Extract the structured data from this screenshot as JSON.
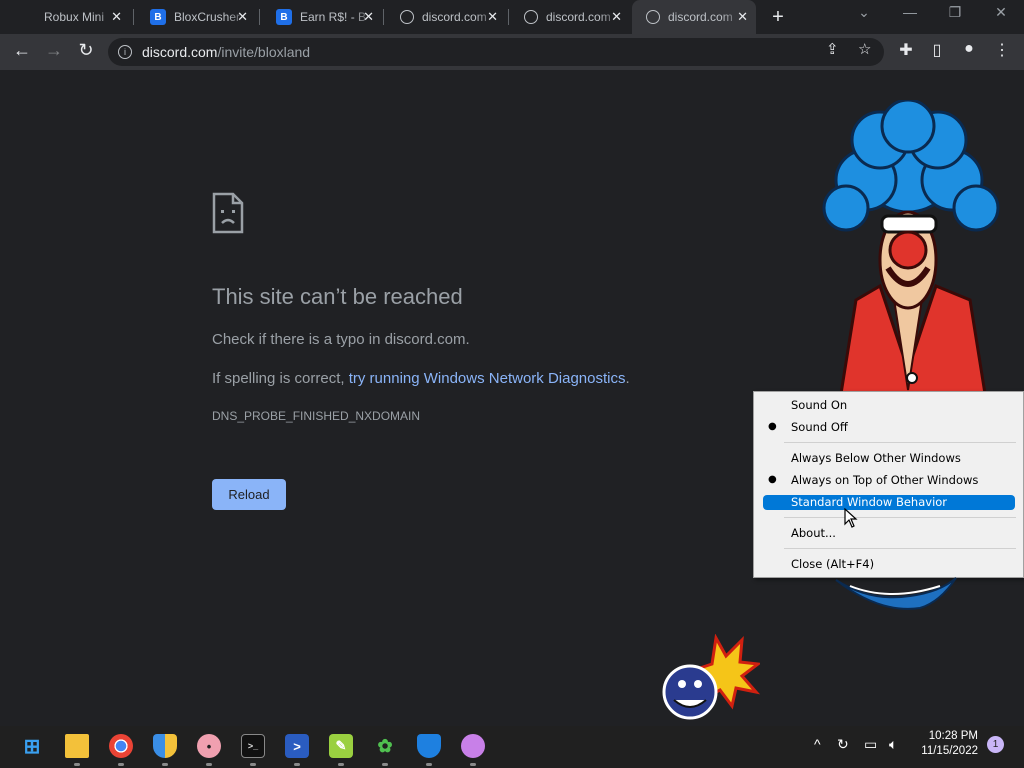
{
  "browser": {
    "tabs": [
      {
        "title": "Robux Mini",
        "favicon": "none",
        "active": false
      },
      {
        "title": "BloxCrusher",
        "favicon": "b-logo-icon",
        "active": false
      },
      {
        "title": "Earn R$! - B",
        "favicon": "b-logo-icon",
        "active": false
      },
      {
        "title": "discord.com",
        "favicon": "globe-icon",
        "active": false
      },
      {
        "title": "discord.com",
        "favicon": "globe-icon",
        "active": false
      },
      {
        "title": "discord.com",
        "favicon": "globe-icon",
        "active": true
      }
    ],
    "address": {
      "domain": "discord.com",
      "path": "/invite/bloxland"
    }
  },
  "error_page": {
    "title": "This site can’t be reached",
    "line1": "Check if there is a typo in discord.com.",
    "line2_prefix": "If spelling is correct, ",
    "line2_link": "try running Windows Network Diagnostics",
    "line2_suffix": ".",
    "code": "DNS_PROBE_FINISHED_NXDOMAIN",
    "reload_label": "Reload"
  },
  "context_menu": {
    "items": [
      {
        "label": "Sound On",
        "checked": false
      },
      {
        "label": "Sound Off",
        "checked": true
      },
      {
        "label": "Always Below Other Windows",
        "checked": false
      },
      {
        "label": "Always on Top of Other Windows",
        "checked": true
      },
      {
        "label": "Standard Window Behavior",
        "checked": false,
        "highlighted": true
      },
      {
        "label": "About...",
        "checked": false
      },
      {
        "label": "Close (Alt+F4)",
        "checked": false
      }
    ]
  },
  "taskbar": {
    "time": "10:28 PM",
    "date": "11/15/2022",
    "notification_count": "1"
  },
  "colors": {
    "page_bg": "#202124",
    "link": "#8ab4f8",
    "menu_highlight": "#0078d7"
  }
}
